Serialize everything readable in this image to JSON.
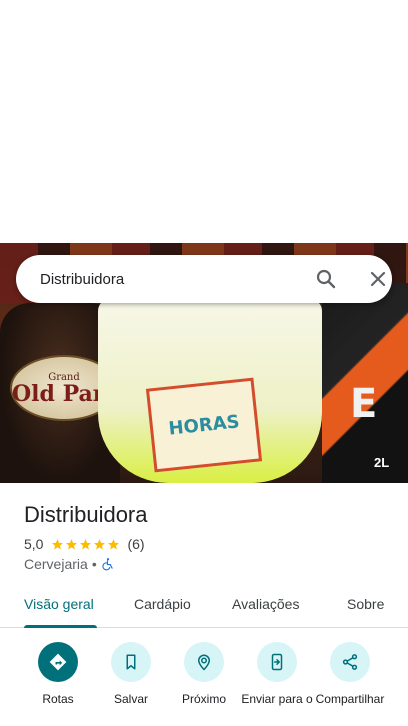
{
  "search": {
    "query": "Distribuidora"
  },
  "hero_image": {
    "bottle_label_top": "Grand",
    "bottle_label_main": "Old Parr",
    "glass_logo": "HORAS",
    "box_letter": "E",
    "box_volume": "2L"
  },
  "place": {
    "name": "Distribuidora",
    "rating": "5,0",
    "review_count": "(6)",
    "stars": 5,
    "category": "Cervejaria",
    "separator": "•"
  },
  "tabs": [
    {
      "label": "Visão geral",
      "active": true
    },
    {
      "label": "Cardápio",
      "active": false
    },
    {
      "label": "Avaliações",
      "active": false
    },
    {
      "label": "Sobre",
      "active": false
    }
  ],
  "actions": [
    {
      "label": "Rotas",
      "icon": "directions-icon"
    },
    {
      "label": "Salvar",
      "icon": "bookmark-icon"
    },
    {
      "label": "Próximo",
      "icon": "nearby-icon"
    },
    {
      "label": "Enviar para o",
      "icon": "send-to-phone-icon"
    },
    {
      "label": "Compartilhar",
      "icon": "share-icon"
    }
  ],
  "colors": {
    "accent": "#00707a",
    "action_bg": "#d7f4f7",
    "star": "#fbbc04"
  }
}
